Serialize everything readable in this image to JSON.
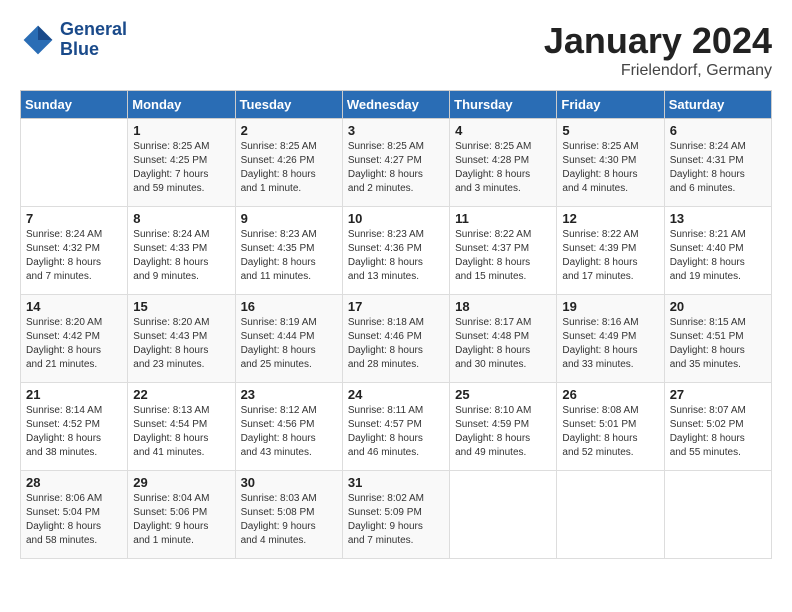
{
  "logo": {
    "line1": "General",
    "line2": "Blue"
  },
  "title": "January 2024",
  "location": "Frielendorf, Germany",
  "days_of_week": [
    "Sunday",
    "Monday",
    "Tuesday",
    "Wednesday",
    "Thursday",
    "Friday",
    "Saturday"
  ],
  "weeks": [
    [
      {
        "day": "",
        "info": ""
      },
      {
        "day": "1",
        "info": "Sunrise: 8:25 AM\nSunset: 4:25 PM\nDaylight: 7 hours\nand 59 minutes."
      },
      {
        "day": "2",
        "info": "Sunrise: 8:25 AM\nSunset: 4:26 PM\nDaylight: 8 hours\nand 1 minute."
      },
      {
        "day": "3",
        "info": "Sunrise: 8:25 AM\nSunset: 4:27 PM\nDaylight: 8 hours\nand 2 minutes."
      },
      {
        "day": "4",
        "info": "Sunrise: 8:25 AM\nSunset: 4:28 PM\nDaylight: 8 hours\nand 3 minutes."
      },
      {
        "day": "5",
        "info": "Sunrise: 8:25 AM\nSunset: 4:30 PM\nDaylight: 8 hours\nand 4 minutes."
      },
      {
        "day": "6",
        "info": "Sunrise: 8:24 AM\nSunset: 4:31 PM\nDaylight: 8 hours\nand 6 minutes."
      }
    ],
    [
      {
        "day": "7",
        "info": "Sunrise: 8:24 AM\nSunset: 4:32 PM\nDaylight: 8 hours\nand 7 minutes."
      },
      {
        "day": "8",
        "info": "Sunrise: 8:24 AM\nSunset: 4:33 PM\nDaylight: 8 hours\nand 9 minutes."
      },
      {
        "day": "9",
        "info": "Sunrise: 8:23 AM\nSunset: 4:35 PM\nDaylight: 8 hours\nand 11 minutes."
      },
      {
        "day": "10",
        "info": "Sunrise: 8:23 AM\nSunset: 4:36 PM\nDaylight: 8 hours\nand 13 minutes."
      },
      {
        "day": "11",
        "info": "Sunrise: 8:22 AM\nSunset: 4:37 PM\nDaylight: 8 hours\nand 15 minutes."
      },
      {
        "day": "12",
        "info": "Sunrise: 8:22 AM\nSunset: 4:39 PM\nDaylight: 8 hours\nand 17 minutes."
      },
      {
        "day": "13",
        "info": "Sunrise: 8:21 AM\nSunset: 4:40 PM\nDaylight: 8 hours\nand 19 minutes."
      }
    ],
    [
      {
        "day": "14",
        "info": "Sunrise: 8:20 AM\nSunset: 4:42 PM\nDaylight: 8 hours\nand 21 minutes."
      },
      {
        "day": "15",
        "info": "Sunrise: 8:20 AM\nSunset: 4:43 PM\nDaylight: 8 hours\nand 23 minutes."
      },
      {
        "day": "16",
        "info": "Sunrise: 8:19 AM\nSunset: 4:44 PM\nDaylight: 8 hours\nand 25 minutes."
      },
      {
        "day": "17",
        "info": "Sunrise: 8:18 AM\nSunset: 4:46 PM\nDaylight: 8 hours\nand 28 minutes."
      },
      {
        "day": "18",
        "info": "Sunrise: 8:17 AM\nSunset: 4:48 PM\nDaylight: 8 hours\nand 30 minutes."
      },
      {
        "day": "19",
        "info": "Sunrise: 8:16 AM\nSunset: 4:49 PM\nDaylight: 8 hours\nand 33 minutes."
      },
      {
        "day": "20",
        "info": "Sunrise: 8:15 AM\nSunset: 4:51 PM\nDaylight: 8 hours\nand 35 minutes."
      }
    ],
    [
      {
        "day": "21",
        "info": "Sunrise: 8:14 AM\nSunset: 4:52 PM\nDaylight: 8 hours\nand 38 minutes."
      },
      {
        "day": "22",
        "info": "Sunrise: 8:13 AM\nSunset: 4:54 PM\nDaylight: 8 hours\nand 41 minutes."
      },
      {
        "day": "23",
        "info": "Sunrise: 8:12 AM\nSunset: 4:56 PM\nDaylight: 8 hours\nand 43 minutes."
      },
      {
        "day": "24",
        "info": "Sunrise: 8:11 AM\nSunset: 4:57 PM\nDaylight: 8 hours\nand 46 minutes."
      },
      {
        "day": "25",
        "info": "Sunrise: 8:10 AM\nSunset: 4:59 PM\nDaylight: 8 hours\nand 49 minutes."
      },
      {
        "day": "26",
        "info": "Sunrise: 8:08 AM\nSunset: 5:01 PM\nDaylight: 8 hours\nand 52 minutes."
      },
      {
        "day": "27",
        "info": "Sunrise: 8:07 AM\nSunset: 5:02 PM\nDaylight: 8 hours\nand 55 minutes."
      }
    ],
    [
      {
        "day": "28",
        "info": "Sunrise: 8:06 AM\nSunset: 5:04 PM\nDaylight: 8 hours\nand 58 minutes."
      },
      {
        "day": "29",
        "info": "Sunrise: 8:04 AM\nSunset: 5:06 PM\nDaylight: 9 hours\nand 1 minute."
      },
      {
        "day": "30",
        "info": "Sunrise: 8:03 AM\nSunset: 5:08 PM\nDaylight: 9 hours\nand 4 minutes."
      },
      {
        "day": "31",
        "info": "Sunrise: 8:02 AM\nSunset: 5:09 PM\nDaylight: 9 hours\nand 7 minutes."
      },
      {
        "day": "",
        "info": ""
      },
      {
        "day": "",
        "info": ""
      },
      {
        "day": "",
        "info": ""
      }
    ]
  ]
}
